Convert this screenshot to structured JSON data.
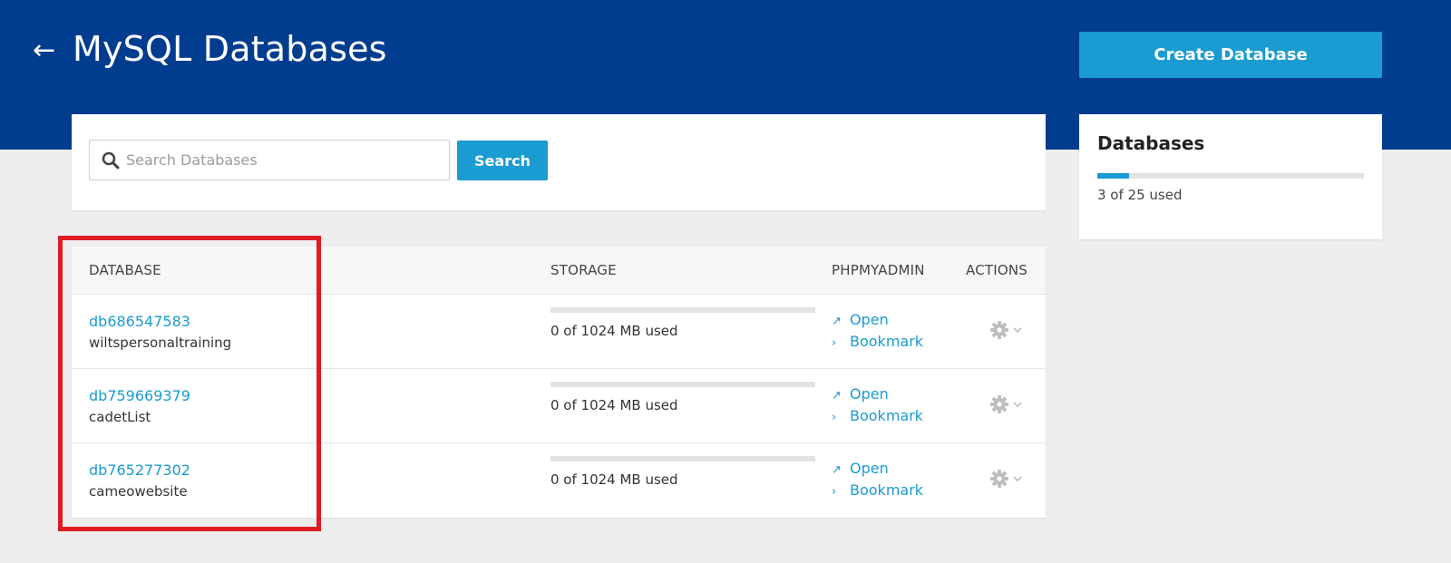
{
  "header": {
    "title": "MySQL Databases",
    "back_icon": "arrow-left-icon",
    "create_button_label": "Create Database"
  },
  "search": {
    "placeholder": "Search Databases",
    "value": "",
    "button_label": "Search",
    "icon": "search-icon"
  },
  "summary": {
    "title": "Databases",
    "used": 3,
    "total": 25,
    "usage_text": "3 of 25 used",
    "usage_fraction": 0.12
  },
  "table": {
    "columns": [
      "DATABASE",
      "STORAGE",
      "PHPMYADMIN",
      "ACTIONS"
    ],
    "rows": [
      {
        "id": "db686547583",
        "name": "wiltspersonaltraining",
        "storage_text": "0 of 1024 MB used",
        "storage_fraction": 0,
        "open_label": "Open",
        "bookmark_label": "Bookmark"
      },
      {
        "id": "db759669379",
        "name": "cadetList",
        "storage_text": "0 of 1024 MB used",
        "storage_fraction": 0,
        "open_label": "Open",
        "bookmark_label": "Bookmark"
      },
      {
        "id": "db765277302",
        "name": "cameowebsite",
        "storage_text": "0 of 1024 MB used",
        "storage_fraction": 0,
        "open_label": "Open",
        "bookmark_label": "Bookmark"
      }
    ]
  },
  "icons": {
    "open": "external-link-icon",
    "bookmark": "chevron-right-icon",
    "actions": "gear-icon",
    "actions_caret": "chevron-down-icon"
  },
  "colors": {
    "header_bg": "#003d8f",
    "accent": "#1a9bd1",
    "page_bg": "#eeeeee",
    "highlight": "#e01b24"
  }
}
